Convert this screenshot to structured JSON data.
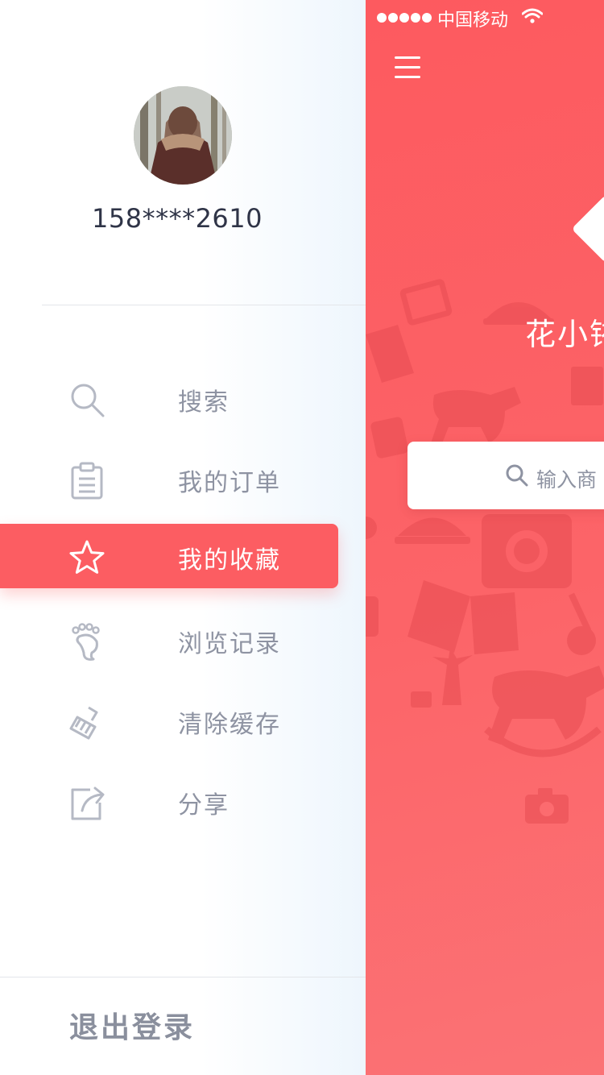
{
  "user": {
    "phone": "158****2610"
  },
  "menu": {
    "items": [
      {
        "label": "搜索",
        "icon": "search-icon",
        "active": false
      },
      {
        "label": "我的订单",
        "icon": "clipboard-icon",
        "active": false
      },
      {
        "label": "我的收藏",
        "icon": "star-icon",
        "active": true
      },
      {
        "label": "浏览记录",
        "icon": "footprint-icon",
        "active": false
      },
      {
        "label": "清除缓存",
        "icon": "broom-icon",
        "active": false
      },
      {
        "label": "分享",
        "icon": "share-icon",
        "active": false
      }
    ]
  },
  "logout_label": "退出登录",
  "status_bar": {
    "carrier": "中国移动"
  },
  "main": {
    "brand_title": "花小铱",
    "search_placeholder": "输入商"
  },
  "colors": {
    "accent": "#fc5d62",
    "menu_text": "#8e93a2",
    "phone_text": "#2f3447"
  }
}
